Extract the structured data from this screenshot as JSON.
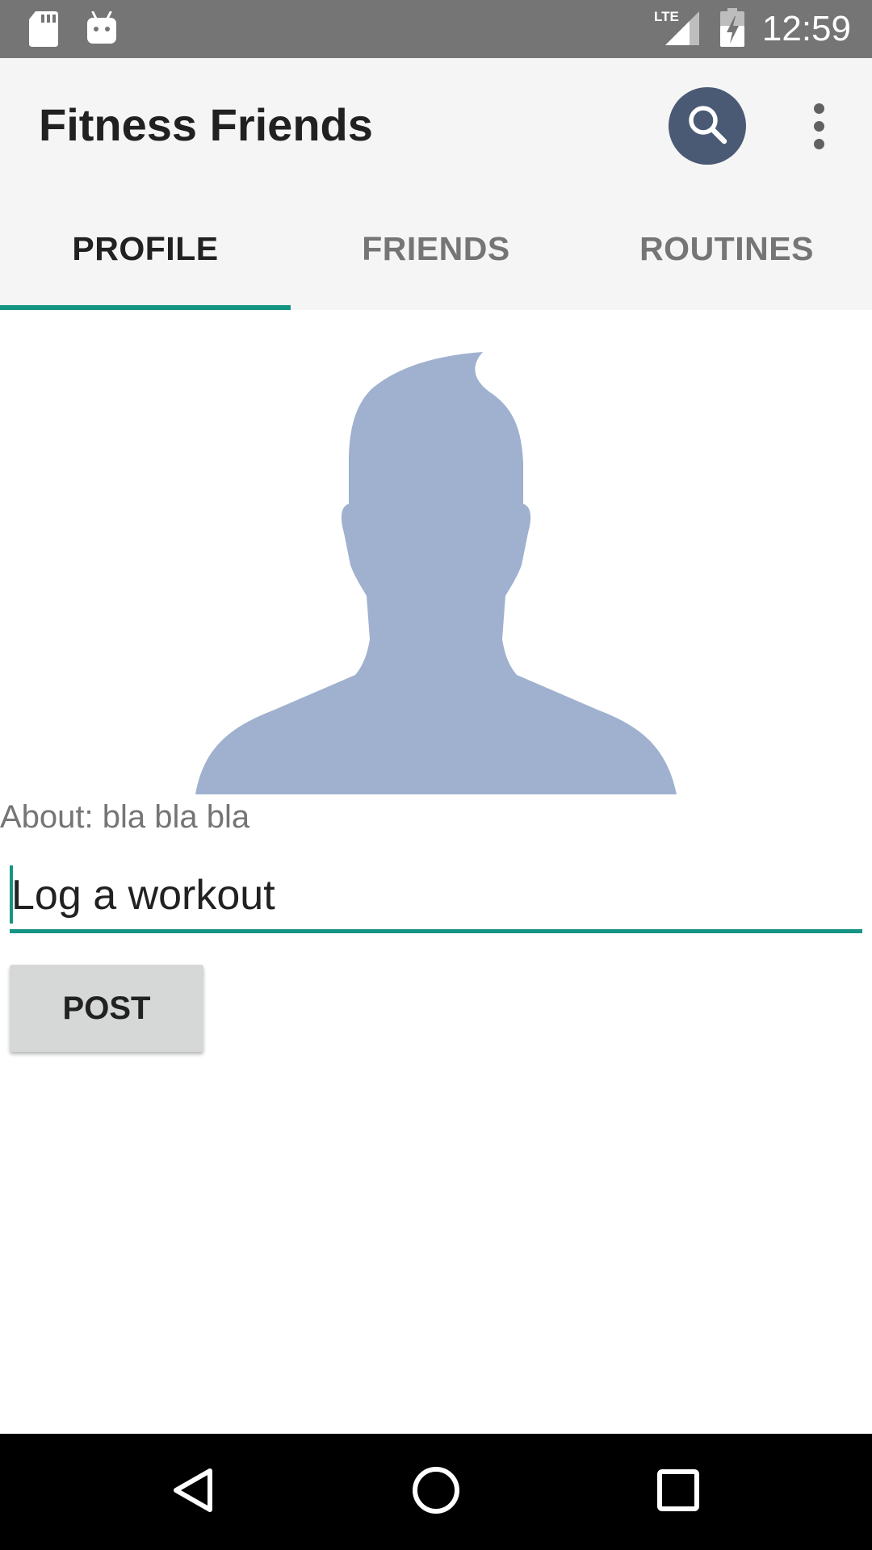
{
  "status_bar": {
    "time": "12:59",
    "network_label": "LTE",
    "icons": [
      "sd-card-icon",
      "android-icon",
      "signal-icon",
      "battery-charging-icon"
    ]
  },
  "app_bar": {
    "title": "Fitness Friends",
    "icons": [
      "search-icon",
      "overflow-menu-icon"
    ],
    "search_button_color": "#4a5a75"
  },
  "tabs": [
    {
      "label": "PROFILE",
      "active": true
    },
    {
      "label": "FRIENDS",
      "active": false
    },
    {
      "label": "ROUTINES",
      "active": false
    }
  ],
  "profile": {
    "avatar_icon": "person-silhouette-icon",
    "about": "About: bla bla bla",
    "workout_input": {
      "value": "Log a workout",
      "placeholder": ""
    },
    "post_label": "POST"
  },
  "nav_bar": {
    "icons": [
      "back-icon",
      "home-icon",
      "recents-icon"
    ]
  },
  "colors": {
    "accent": "#159484",
    "status_bar": "#757575",
    "app_bar": "#f5f5f5",
    "avatar": "#9fb1cf"
  }
}
